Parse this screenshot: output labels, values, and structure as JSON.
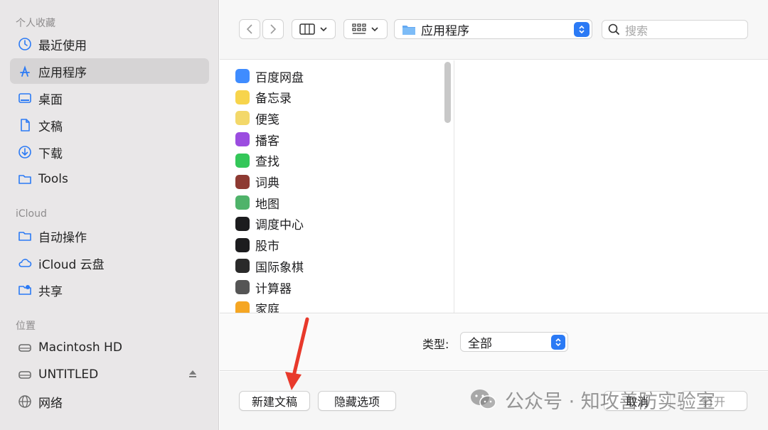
{
  "sidebar": {
    "sections": [
      {
        "label": "个人收藏"
      },
      {
        "label": "iCloud"
      },
      {
        "label": "位置"
      }
    ],
    "favorites": [
      {
        "label": "最近使用",
        "icon": "clock-icon"
      },
      {
        "label": "应用程序",
        "icon": "app-store-a-icon",
        "selected": true
      },
      {
        "label": "桌面",
        "icon": "desktop-icon"
      },
      {
        "label": "文稿",
        "icon": "document-icon"
      },
      {
        "label": "下载",
        "icon": "download-icon"
      },
      {
        "label": "Tools",
        "icon": "folder-icon"
      }
    ],
    "icloud": [
      {
        "label": "自动操作",
        "icon": "folder-icon"
      },
      {
        "label": "iCloud 云盘",
        "icon": "cloud-icon"
      },
      {
        "label": "共享",
        "icon": "shared-folder-icon"
      }
    ],
    "locations": [
      {
        "label": "Macintosh HD",
        "icon": "disk-icon"
      },
      {
        "label": "UNTITLED",
        "icon": "disk-icon",
        "ejectable": true
      },
      {
        "label": "网络",
        "icon": "globe-icon"
      }
    ]
  },
  "toolbar": {
    "location_label": "应用程序",
    "search_placeholder": "搜索"
  },
  "browser": {
    "files": [
      {
        "label": "百度网盘",
        "color": "#3f8cff"
      },
      {
        "label": "备忘录",
        "color": "#f7d44c"
      },
      {
        "label": "便笺",
        "color": "#f3d86a"
      },
      {
        "label": "播客",
        "color": "#9b4de0"
      },
      {
        "label": "查找",
        "color": "#34c759"
      },
      {
        "label": "词典",
        "color": "#8e3a32"
      },
      {
        "label": "地图",
        "color": "#4fb36a"
      },
      {
        "label": "调度中心",
        "color": "#1c1c1e"
      },
      {
        "label": "股市",
        "color": "#1c1c1e"
      },
      {
        "label": "国际象棋",
        "color": "#2a2a2a"
      },
      {
        "label": "计算器",
        "color": "#555555"
      },
      {
        "label": "家庭",
        "color": "#f5a623"
      }
    ]
  },
  "filter": {
    "type_label": "类型:",
    "type_value": "全部"
  },
  "buttons": {
    "new_document": "新建文稿",
    "hide_options": "隐藏选项",
    "cancel": "取消",
    "open": "打开"
  },
  "watermark": {
    "text": "公众号 · 知攻善防实验室"
  },
  "colors": {
    "accent": "#2b7af5",
    "sidebar_bg": "#e9e7e8",
    "annotation_arrow": "#e8392b"
  }
}
